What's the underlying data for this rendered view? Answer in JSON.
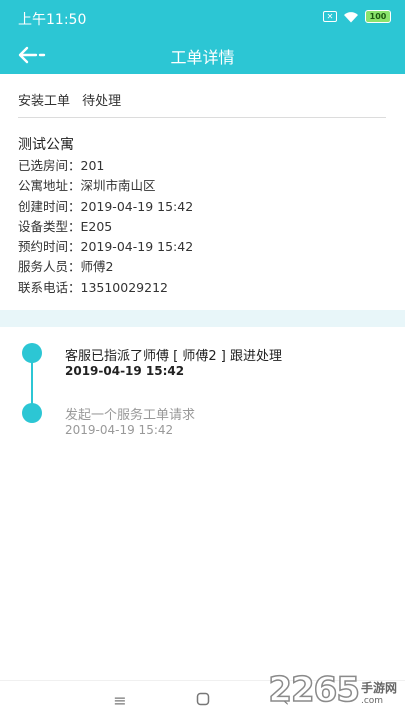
{
  "status_bar": {
    "time": "上午11:50",
    "battery": "100"
  },
  "nav": {
    "title": "工单详情"
  },
  "order": {
    "type": "安装工单",
    "status": "待处理"
  },
  "apartment": {
    "name": "测试公寓",
    "rows": [
      "已选房间：201",
      "公寓地址：深圳市南山区",
      "创建时间：2019-04-19 15:42",
      "设备类型：E205",
      "预约时间：2019-04-19 15:42",
      "服务人员：师傅2",
      "联系电话：13510029212"
    ]
  },
  "timeline": [
    {
      "title": "客服已指派了师傅 [ 师傅2 ] 跟进处理",
      "time": "2019-04-19 15:42"
    },
    {
      "title": "发起一个服务工单请求",
      "time": "2019-04-19 15:42"
    }
  ],
  "watermark": {
    "number": "2265",
    "site_name": "手游网",
    "site_url": ".com"
  },
  "colors": {
    "accent": "#2cc6d4",
    "band": "#e8f6f9",
    "muted_text": "#999999"
  },
  "icons": {
    "back": "arrow-left-icon",
    "wifi": "wifi-icon",
    "sim": "sim-x-icon",
    "menu": "menu-lines-icon",
    "home": "square-home-icon",
    "system_back": "triangle-back-icon"
  }
}
